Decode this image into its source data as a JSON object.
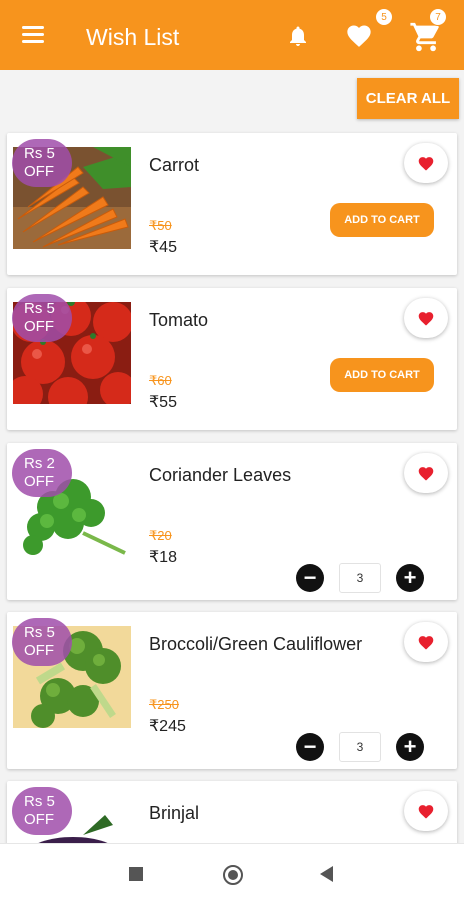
{
  "appbar": {
    "title": "Wish List",
    "menu_icon": "hamburger-menu-icon",
    "bell_icon": "bell-icon",
    "wishlist_icon": "heart-icon",
    "wishlist_count": "5",
    "cart_icon": "cart-icon",
    "cart_count": "7",
    "color": "#f7941d"
  },
  "actions": {
    "clear_all": "CLEAR ALL"
  },
  "items": [
    {
      "name": "Carrot",
      "discount_line1": "Rs  5",
      "discount_line2": "OFF",
      "mrp": "₹50",
      "price": "₹45",
      "action": "ADD TO CART"
    },
    {
      "name": "Tomato",
      "discount_line1": "Rs  5",
      "discount_line2": "OFF",
      "mrp": "₹60",
      "price": "₹55",
      "action": "ADD TO CART"
    },
    {
      "name": "Coriander Leaves",
      "discount_line1": "Rs  2",
      "discount_line2": "OFF",
      "mrp": "₹20",
      "price": "₹18",
      "quantity": "3"
    },
    {
      "name": "Broccoli/Green Cauliflower",
      "discount_line1": "Rs  5",
      "discount_line2": "OFF",
      "mrp": "₹250",
      "price": "₹245",
      "quantity": "3"
    },
    {
      "name": "Brinjal",
      "discount_line1": "Rs  5",
      "discount_line2": "OFF"
    }
  ],
  "navbar": {
    "recents_icon": "square-recents-icon",
    "home_icon": "circle-home-icon",
    "back_icon": "triangle-back-icon"
  }
}
